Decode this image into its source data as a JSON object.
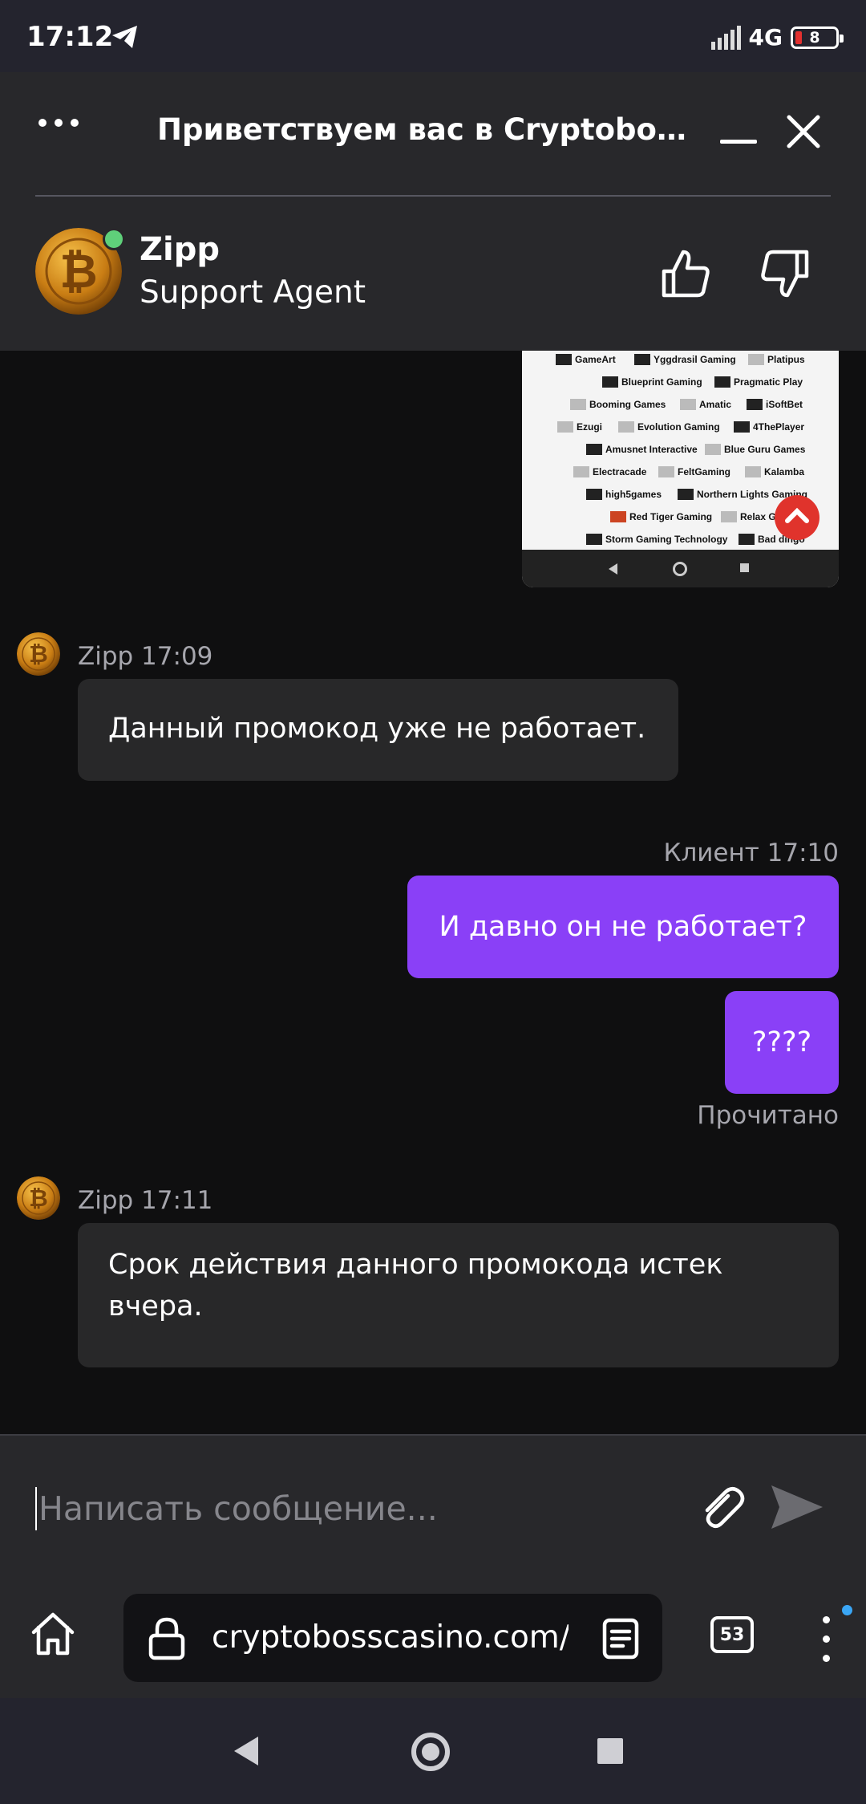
{
  "status_bar": {
    "time": "17:12",
    "network": "4G",
    "battery": "8"
  },
  "chat_header": {
    "title": "Приветствуем вас в Cryptoboss ...",
    "agent_name": "Zipp",
    "agent_role": "Support Agent"
  },
  "shared_image": {
    "providers": [
      "GameArt",
      "Yggdrasil Gaming",
      "Platipus",
      "Blueprint Gaming",
      "Pragmatic Play",
      "Booming Games",
      "Amatic",
      "iSoftBet",
      "Ezugi",
      "Evolution Gaming",
      "4ThePlayer",
      "Amusnet Interactive",
      "Blue Guru Games",
      "Electracade",
      "FeltGaming",
      "Kalamba",
      "high5games",
      "Northern Lights Gaming",
      "Red Tiger Gaming",
      "Relax Gaming",
      "Storm Gaming Technology",
      "Bad dingo"
    ]
  },
  "messages": [
    {
      "sender": "Zipp",
      "time": "17:09",
      "text": "Данный промокод уже не работает."
    },
    {
      "sender": "Клиент",
      "time": "17:10",
      "text": "И давно он не работает?"
    },
    {
      "sender": "Клиент",
      "time": "17:10",
      "text": "????"
    },
    {
      "sender": "Zipp",
      "time": "17:11",
      "text": "Срок действия данного промокода истек вчера."
    }
  ],
  "meta": {
    "agent_0": "Zipp 17:09",
    "client_1": "Клиент 17:10",
    "agent_2": "Zipp 17:11",
    "read_status": "Прочитано"
  },
  "composer": {
    "placeholder": "Написать сообщение..."
  },
  "browser": {
    "url": "cryptobosscasino.com/p",
    "tab_count": "53"
  },
  "icons": {
    "status": [
      "telegram-icon",
      "signal-icon",
      "battery-icon"
    ],
    "header": [
      "more-icon",
      "minimize-icon",
      "close-icon",
      "bitcoin-avatar-icon",
      "thumbs-up-icon",
      "thumbs-down-icon"
    ],
    "composer": [
      "paperclip-icon",
      "send-icon"
    ],
    "browser": [
      "home-icon",
      "lock-icon",
      "reader-mode-icon",
      "tabs-icon",
      "kebab-menu-icon"
    ],
    "nav": [
      "back-icon",
      "home-circle-icon",
      "recents-icon"
    ]
  },
  "colors": {
    "accent": "#8a40f7",
    "online": "#5fd07a",
    "background": "#0f0f10",
    "header": "#28282b"
  }
}
